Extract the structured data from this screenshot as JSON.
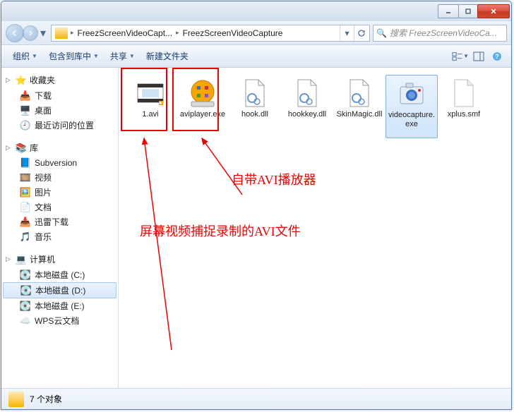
{
  "window": {
    "min_tip": "Minimize",
    "max_tip": "Maximize",
    "close_tip": "Close"
  },
  "address": {
    "crumb1": "FreezScreenVideoCapt...",
    "crumb2": "FreezScreenVideoCapture"
  },
  "search": {
    "placeholder": "搜索 FreezScreenVideoCa..."
  },
  "toolbar": {
    "organize": "组织",
    "include": "包含到库中",
    "share": "共享",
    "newfolder": "新建文件夹"
  },
  "sidebar": {
    "favorites": {
      "label": "收藏夹",
      "items": [
        "下载",
        "桌面",
        "最近访问的位置"
      ]
    },
    "libraries": {
      "label": "库",
      "items": [
        "Subversion",
        "视频",
        "图片",
        "文档",
        "迅雷下载",
        "音乐"
      ]
    },
    "computer": {
      "label": "计算机",
      "items": [
        "本地磁盘 (C:)",
        "本地磁盘 (D:)",
        "本地磁盘 (E:)",
        "WPS云文档"
      ]
    }
  },
  "files": [
    {
      "name": "1.avi",
      "type": "video"
    },
    {
      "name": "aviplayer.exe",
      "type": "player"
    },
    {
      "name": "hook.dll",
      "type": "dll"
    },
    {
      "name": "hookkey.dll",
      "type": "dll"
    },
    {
      "name": "SkinMagic.dll",
      "type": "dll"
    },
    {
      "name": "videocapture.exe",
      "type": "camera",
      "selected": true
    },
    {
      "name": "xplus.smf",
      "type": "generic"
    }
  ],
  "annotations": {
    "text1": "自带AVI播放器",
    "text2": "屏幕视频捕捉录制的AVI文件"
  },
  "status": {
    "count": "7 个对象"
  }
}
